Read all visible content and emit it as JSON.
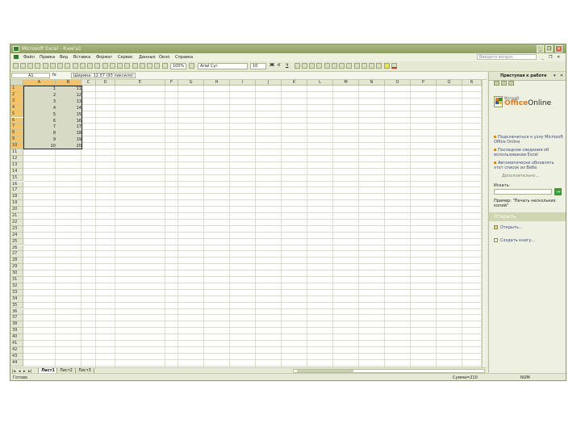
{
  "window": {
    "title": "Microsoft Excel - Книга1"
  },
  "menu": [
    "Файл",
    "Правка",
    "Вид",
    "Вставка",
    "Формат",
    "Сервис",
    "Данные",
    "Окно",
    "Справка"
  ],
  "help_box": "Введите вопрос",
  "toolbar": {
    "zoom": "100%",
    "font": "Arial Cyr",
    "size": "10",
    "bold": "Ж",
    "italic": "К",
    "underline": "Ч"
  },
  "formula_bar": {
    "cell": "A1",
    "fx": "fx",
    "tooltip": "Ширина: 12,57 (93 пикселя)"
  },
  "columns": [
    "A",
    "B",
    "C",
    "D",
    "E",
    "F",
    "G",
    "H",
    "I",
    "J",
    "K",
    "L",
    "M",
    "N",
    "O",
    "P",
    "Q",
    "R"
  ],
  "rows": [
    "1",
    "2",
    "3",
    "4",
    "5",
    "6",
    "7",
    "8",
    "9",
    "10",
    "11",
    "12",
    "13",
    "14",
    "15",
    "16",
    "17",
    "18",
    "19",
    "20",
    "21",
    "22",
    "23",
    "24",
    "25",
    "26",
    "27",
    "28",
    "29",
    "30",
    "31",
    "32",
    "33",
    "34",
    "35",
    "36",
    "37",
    "38",
    "39",
    "40",
    "41",
    "42",
    "43",
    "44"
  ],
  "cells": {
    "A": [
      "1",
      "2",
      "3",
      "4",
      "5",
      "6",
      "7",
      "8",
      "9",
      "10"
    ],
    "B": [
      "11",
      "12",
      "13",
      "14",
      "15",
      "16",
      "17",
      "18",
      "19",
      "20"
    ]
  },
  "sheet_tabs": [
    "Лист1",
    "Лист2",
    "Лист3"
  ],
  "status": {
    "left": "Готово",
    "sum": "Сумма=210",
    "num": "NUM"
  },
  "task_pane": {
    "title": "Приступая к работе",
    "logo_ms": "Microsoft",
    "logo_office": "Office",
    "logo_online": "Online",
    "links": [
      "Подключиться к узлу Microsoft Office Online",
      "Последние сведения об использовании Excel",
      "Автоматически обновлять этот список из Веба"
    ],
    "more": "Дополнительно...",
    "search_label": "Искать:",
    "search_go": "→",
    "example": "Пример: \"Печать нескольких копий\"",
    "open_section": "Открыть",
    "open_items": [
      "Открыть...",
      "Создать книгу..."
    ]
  },
  "colors": {
    "title": "#8fa063",
    "selected_header": "#f5c36b",
    "close": "#cf6a3f"
  }
}
